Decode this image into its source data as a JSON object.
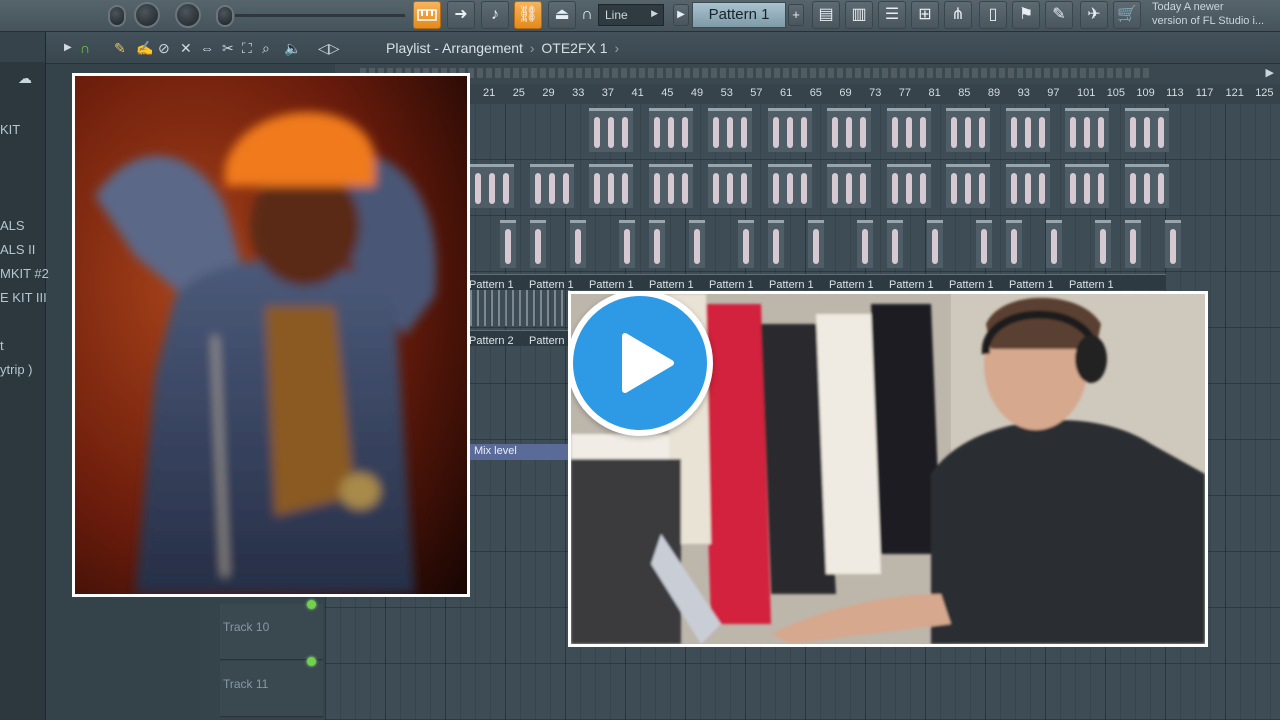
{
  "toolbar": {
    "snap_mode": "Line",
    "pattern": "Pattern 1",
    "hint_line1": "Today  A newer",
    "hint_line2": "version of FL Studio i..."
  },
  "playlist": {
    "title": "Playlist - Arrangement",
    "separator": "›",
    "clip_source": "OTE2FX 1"
  },
  "browser": {
    "items": [
      "KIT",
      "ALS",
      "ALS II",
      "MKIT #2",
      "E KIT III",
      "t",
      "ytrip )"
    ]
  },
  "ruler": {
    "bars": [
      "21",
      "25",
      "29",
      "33",
      "37",
      "41",
      "45",
      "49",
      "53",
      "57",
      "61",
      "65",
      "69",
      "73",
      "77",
      "81",
      "85",
      "89",
      "93",
      "97",
      "101",
      "105",
      "109",
      "113",
      "117",
      "121",
      "125"
    ]
  },
  "tracks": [
    {
      "name": "Track 10"
    },
    {
      "name": "Track 11"
    }
  ],
  "lanes": {
    "pattern1_label": "Pattern 1",
    "pattern1_count": 11,
    "pattern2_labels": [
      "Pattern 2",
      "Pattern"
    ],
    "mix_level": "Mix level"
  },
  "overlays": {
    "left_image": "Blurred photo of a singer in an orange beanie and dark coat on stage",
    "right_video": "Video thumbnail of a man wearing headphones at a laptop in front of a clothes rack",
    "play_icon": "play-icon"
  },
  "colors": {
    "accent": "#e48a1c",
    "play_button": "#2e9ae6",
    "led": "#6fd24a"
  }
}
